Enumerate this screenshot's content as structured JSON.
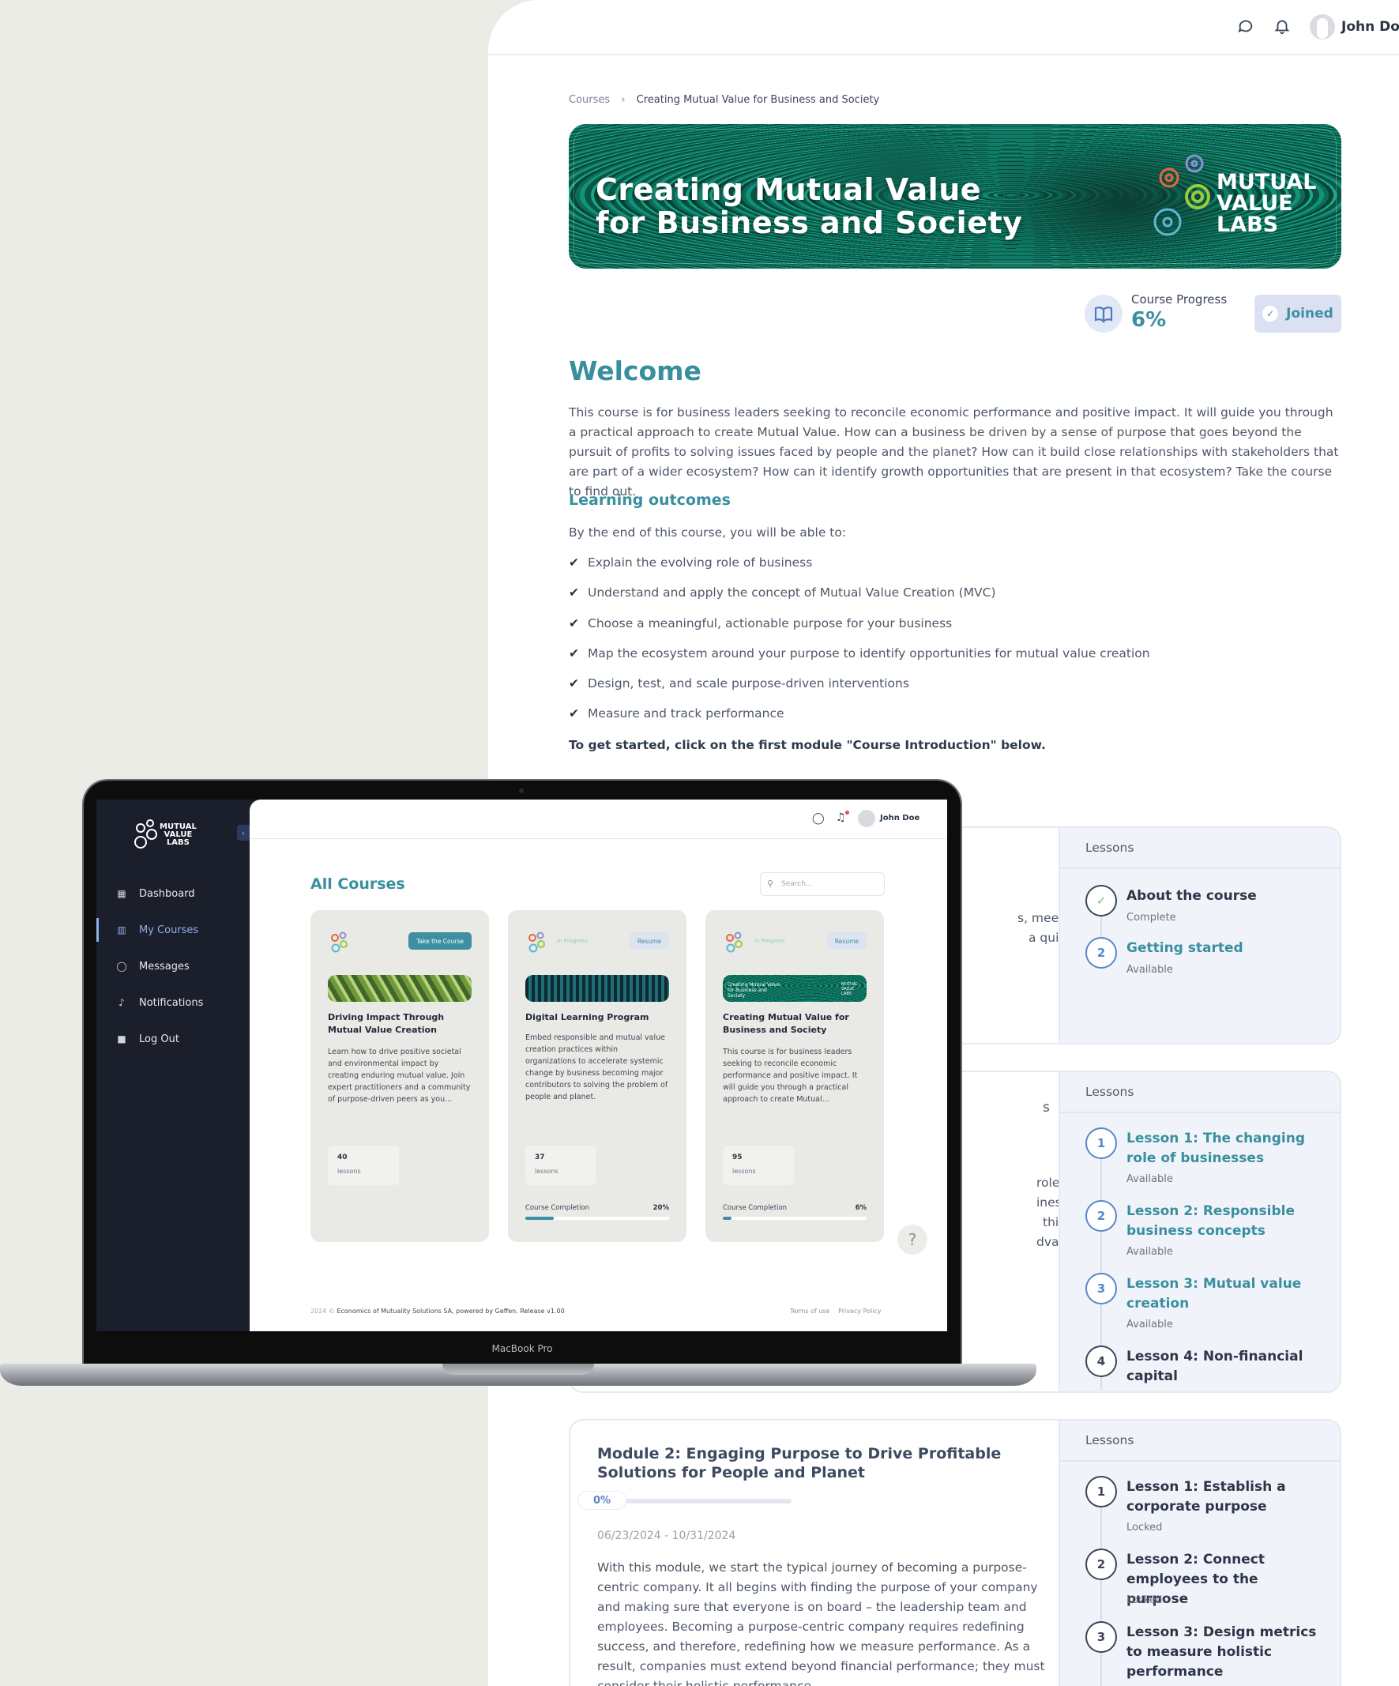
{
  "topbar": {
    "chat_icon": "chat-icon",
    "bell_icon": "bell-icon",
    "user_name": "John Doe"
  },
  "breadcrumb": {
    "root": "Courses",
    "current": "Creating Mutual Value for Business and Society"
  },
  "hero": {
    "title": "Creating Mutual Value for Business and Society",
    "logo_text": "MUTUAL\nVALUE\nLABS"
  },
  "progress": {
    "label": "Course Progress",
    "value": "6%",
    "percent": 6
  },
  "joined_label": "Joined",
  "welcome": {
    "title": "Welcome",
    "intro": "This course is for business leaders seeking to reconcile economic performance and positive impact. It will guide you through a practical approach to create Mutual Value. How can a business be driven by a sense of purpose that goes beyond the pursuit of profits to solving issues faced by people and the planet? How can it build close relationships with stakeholders that are part of a wider ecosystem? How can it identify growth opportunities that are present in that ecosystem? Take the course to find out."
  },
  "learning_outcomes": {
    "title": "Learning outcomes",
    "lead": "By the end of this course, you will be able to:",
    "items": [
      "Explain the evolving role of business",
      "Understand and apply the concept of Mutual Value Creation (MVC)",
      "Choose a meaningful, actionable purpose for your business",
      "Map the ecosystem around your purpose to identify opportunities for mutual value creation",
      "Design, test, and scale purpose-driven interventions",
      "Measure and track performance"
    ],
    "cta": "To get started, click on the first module \"Course Introduction\" below."
  },
  "modules": [
    {
      "fragments": [
        "s, meet the",
        "a quick"
      ],
      "lessons_label": "Lessons",
      "lessons": [
        {
          "num": "✓",
          "title": "About the course",
          "status": "Complete"
        },
        {
          "num": "2",
          "title": "Getting started",
          "status": "Available"
        }
      ]
    },
    {
      "fragments": [
        "s",
        "role of",
        "iness",
        "this context,",
        "dvance the"
      ],
      "lessons_label": "Lessons",
      "lessons": [
        {
          "num": "1",
          "title": "Lesson 1: The changing role of businesses",
          "status": "Available"
        },
        {
          "num": "2",
          "title": "Lesson 2: Responsible business concepts",
          "status": "Available"
        },
        {
          "num": "3",
          "title": "Lesson 3: Mutual value creation",
          "status": "Available"
        },
        {
          "num": "4",
          "title": "Lesson 4: Non-financial capital",
          "status": ""
        }
      ]
    },
    {
      "title": "Module 2: Engaging Purpose to Drive Profitable Solutions for People and Planet",
      "progress": "0%",
      "dates": "06/23/2024 - 10/31/2024",
      "body": "With this module, we start the typical journey of becoming a purpose-centric company. It all begins with finding the purpose of your company and making sure that everyone is on board – the leadership team and employees. Becoming a purpose-centric company requires redefining success, and therefore, redefining how we measure performance. As a result, companies must extend beyond financial performance; they must consider their holistic performance.",
      "lessons_label": "Lessons",
      "lessons": [
        {
          "num": "1",
          "title": "Lesson 1: Establish a corporate purpose",
          "status": "Locked"
        },
        {
          "num": "2",
          "title": "Lesson 2: Connect employees to the purpose",
          "status": "Locked"
        },
        {
          "num": "3",
          "title": "Lesson 3: Design metrics to measure holistic performance",
          "status": ""
        }
      ]
    }
  ],
  "laptop": {
    "model_label": "MacBook Pro",
    "logo_text": "MUTUAL\nVALUE\nLABS",
    "nav": [
      {
        "label": "Dashboard",
        "icon": "grid-icon"
      },
      {
        "label": "My Courses",
        "icon": "books-icon"
      },
      {
        "label": "Messages",
        "icon": "chat-icon"
      },
      {
        "label": "Notifications",
        "icon": "bell-icon"
      },
      {
        "label": "Log Out",
        "icon": "lock-icon"
      }
    ],
    "user_name": "John Doe",
    "page_title": "All Courses",
    "search_placeholder": "Search...",
    "cards": [
      {
        "action": "Take the Course",
        "badge": "",
        "title": "Driving Impact Through Mutual Value Creation",
        "desc": "Learn how to drive positive societal and environmental impact by creating enduring mutual value. Join expert practitioners and a community of purpose-driven peers as you...",
        "lessons_count": "40",
        "lessons_label": "lessons",
        "completion_label": "",
        "completion_value": "",
        "completion_percent": 0
      },
      {
        "action": "Resume",
        "badge": "In Progress",
        "title": "Digital Learning Program",
        "desc": "Embed responsible and mutual value creation practices within organizations to accelerate systemic change by business becoming major contributors to solving the problem of people and planet.",
        "lessons_count": "37",
        "lessons_label": "lessons",
        "completion_label": "Course Completion",
        "completion_value": "20%",
        "completion_percent": 20
      },
      {
        "action": "Resume",
        "badge": "In Progress",
        "title": "Creating Mutual Value for Business and Society",
        "desc": "This course is for business leaders seeking to reconcile economic performance and positive impact. It will guide you through a practical approach to create Mutual...",
        "lessons_count": "95",
        "lessons_label": "lessons",
        "completion_label": "Course Completion",
        "completion_value": "6%",
        "completion_percent": 6,
        "thumb_title": "Creating Mutual Value for Business and Society",
        "thumb_logo": "MUTUAL VALUE LABS"
      }
    ],
    "help_label": "?",
    "footer": {
      "year": "2024 ©",
      "text": "Economics of Mutuality Solutions SA, powered by Geffen. Release v1.00",
      "terms": "Terms of use",
      "privacy": "Privacy Policy"
    }
  }
}
